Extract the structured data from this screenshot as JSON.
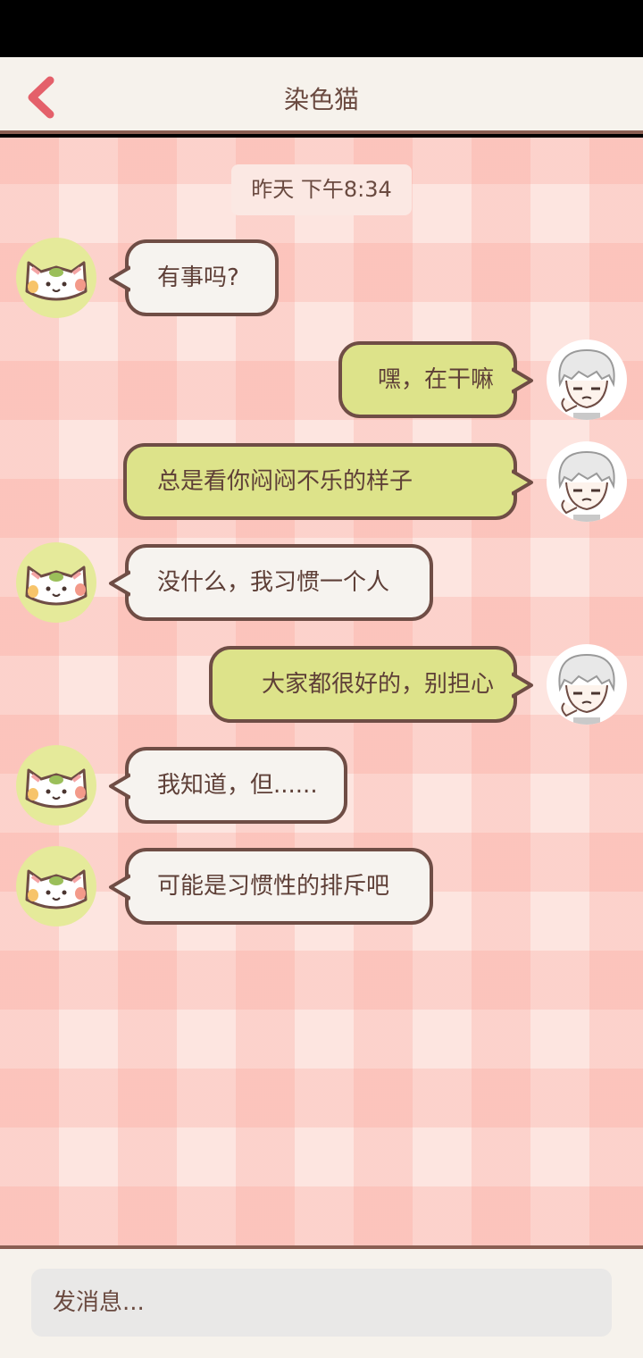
{
  "header": {
    "title": "染色猫",
    "back_icon": "chevron-left-icon"
  },
  "chat": {
    "timestamp": "昨天 下午8:34",
    "messages": [
      {
        "from": "cat",
        "text": "有事吗?"
      },
      {
        "from": "user",
        "text": "嘿，在干嘛"
      },
      {
        "from": "user",
        "text": "总是看你闷闷不乐的样子"
      },
      {
        "from": "cat",
        "text": "没什么，我习惯一个人"
      },
      {
        "from": "user",
        "text": "大家都很好的，别担心"
      },
      {
        "from": "cat",
        "text": "我知道，但......"
      },
      {
        "from": "cat",
        "text": "可能是习惯性的排斥吧"
      }
    ]
  },
  "composer": {
    "placeholder": "发消息..."
  },
  "colors": {
    "accent_back": "#e4606a",
    "incoming_bubble": "#f6f3ef",
    "outgoing_bubble": "#dde38a",
    "bubble_border": "#6f4d45",
    "background": "#fde5e0"
  }
}
